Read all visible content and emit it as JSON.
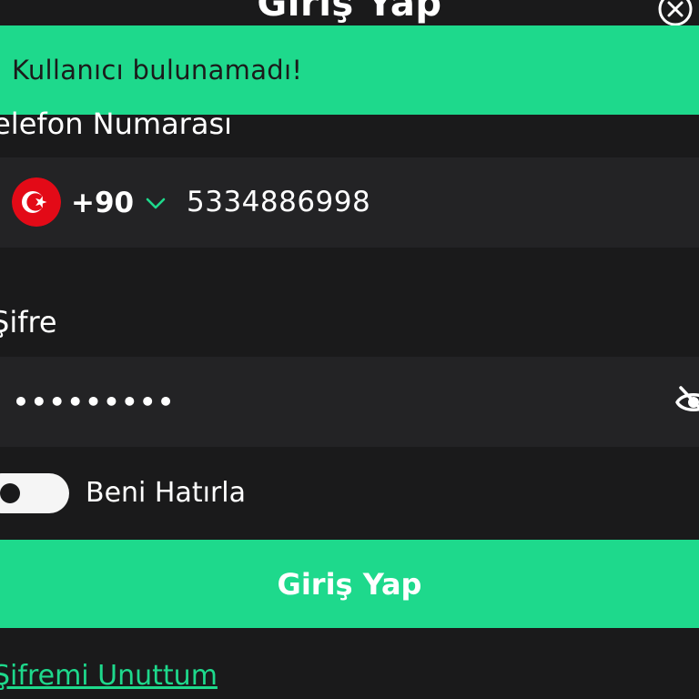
{
  "header": {
    "title": "Giriş Yap",
    "close_icon": "close-icon"
  },
  "toast": {
    "message": "Kullanıcı bulunamadı!",
    "color": "#1ed98c"
  },
  "form": {
    "phone": {
      "label": "Telefon Numarası",
      "flag_icon": "turkey-flag-icon",
      "dial_code": "+90",
      "value": "5334886998"
    },
    "password": {
      "label": "Şifre",
      "value": "•••••••••",
      "visibility_icon": "eye-off-icon"
    },
    "remember_me": {
      "label": "Beni Hatırla",
      "checked": false
    },
    "submit_label": "Giriş Yap",
    "forgot_password_label": "Şifremi Unuttum"
  },
  "colors": {
    "accent": "#1ed98c",
    "background": "#1a1a1b",
    "field_background": "#232325"
  }
}
